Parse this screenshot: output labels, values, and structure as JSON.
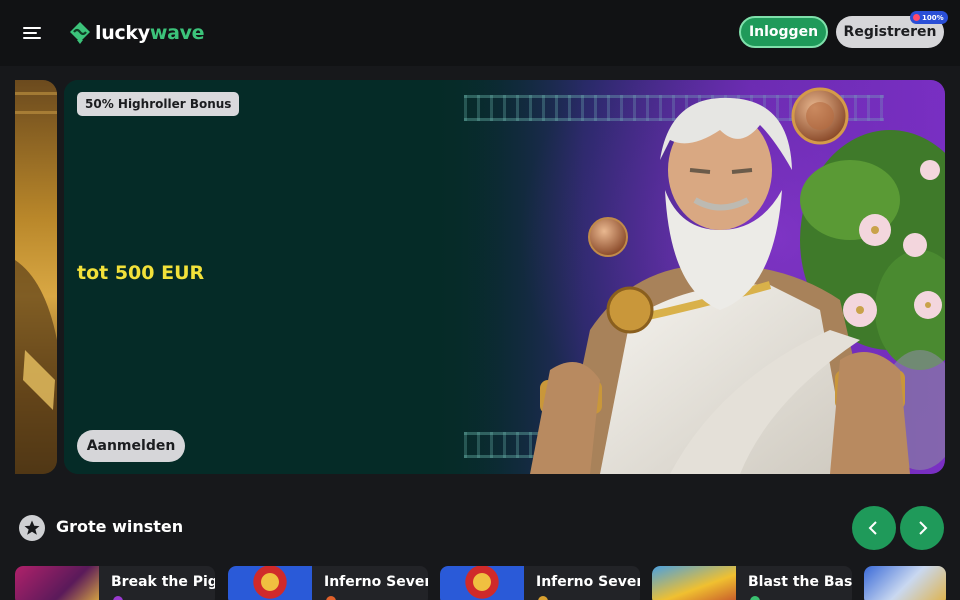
{
  "header": {
    "logo": {
      "part1": "lucky",
      "part2": "wave"
    },
    "login_label": "Inloggen",
    "register_label": "Registreren",
    "register_badge": "100%"
  },
  "banner": {
    "tag": "50% Highroller Bonus",
    "headline": "tot 500 EUR",
    "cta_label": "Aanmelden"
  },
  "section": {
    "title": "Grote winsten"
  },
  "wins": [
    {
      "name": "Break the Pig"
    },
    {
      "name": "Inferno Seven"
    },
    {
      "name": "Inferno Seven"
    },
    {
      "name": "Blast the Bass"
    }
  ],
  "colors": {
    "accent_green": "#1f9a5a",
    "promo_yellow": "#f2e13a",
    "background": "#17181b"
  }
}
